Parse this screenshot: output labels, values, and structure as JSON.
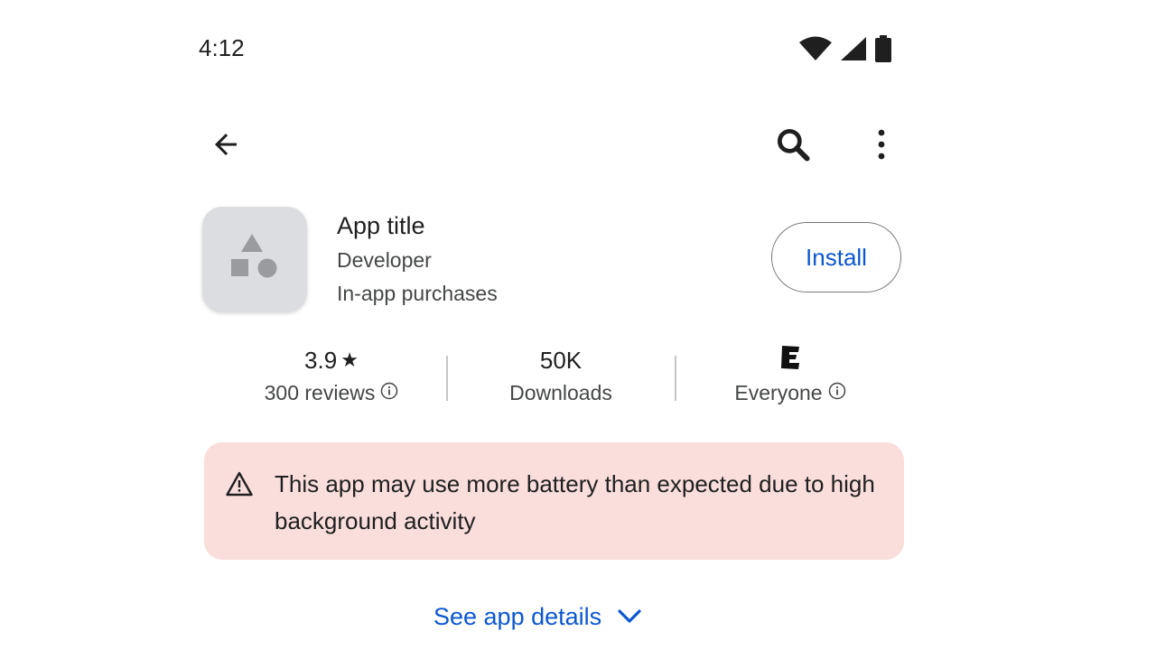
{
  "status_bar": {
    "time": "4:12",
    "icons": [
      "wifi-icon",
      "cellular-signal-icon",
      "battery-icon"
    ]
  },
  "toolbar": {
    "back_icon": "arrow-back-icon",
    "search_icon": "search-icon",
    "more_icon": "more-vert-icon"
  },
  "app": {
    "icon": "shapes-placeholder-icon",
    "title": "App title",
    "developer": "Developer",
    "purchases": "In-app purchases",
    "install_label": "Install"
  },
  "stats": {
    "rating": {
      "value": "3.9",
      "star": "★",
      "label": "300 reviews",
      "info_icon": "info-icon"
    },
    "downloads": {
      "value": "50K",
      "label": "Downloads"
    },
    "content_rating": {
      "badge_icon": "esrb-everyone-icon",
      "label": "Everyone",
      "info_icon": "info-icon"
    }
  },
  "warning": {
    "icon": "warning-icon",
    "text": "This app may use more battery than expected due to high background activity"
  },
  "details": {
    "label": "See app details",
    "icon": "chevron-down-icon"
  },
  "colors": {
    "accent": "#0b57d0",
    "warning_bg": "#f9dedc",
    "icon_bg": "#dcdde0",
    "text_primary": "#1f1f1f",
    "text_secondary": "#444746"
  }
}
